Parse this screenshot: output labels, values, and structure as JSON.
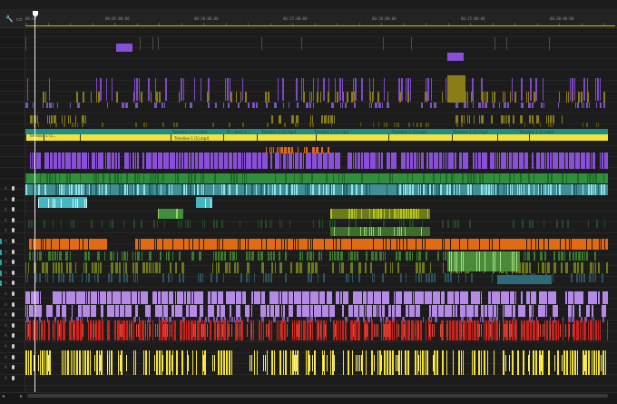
{
  "toolbar": {
    "wrench_icon": "wrench-icon",
    "wrench_glyph": "🔧",
    "markers_icon": "timeline-display-icon",
    "markers_glyph": "▭"
  },
  "ruler": {
    "start_label": "00:00",
    "timecodes": [
      "00:05:00:00",
      "00:10:00:00",
      "00:15:00:00",
      "00:20:00:00",
      "00:25:00:00",
      "00:30:00:00"
    ]
  },
  "clip_labels": {
    "v1": [
      "Timeline 1 (1...",
      "Timeline 1 (1).mp4",
      "Tr • Hme 1 (...",
      "Timeline 1 (1).mp4",
      "Timeline 1 (1).mp4",
      "Timeline 1 (1).mp4",
      "Timeline 1 (1).mp4",
      "Timeline 1 (1).mp4",
      "Timeline 1 (1).mp4"
    ]
  },
  "track_names": [
    "A",
    "A",
    "A",
    "A",
    "A",
    "A",
    "A",
    "A",
    "A",
    "A",
    "A",
    "A",
    "A",
    "A",
    "A",
    "A",
    "A",
    "A",
    "A"
  ],
  "colors": {
    "background": "#1c1c1c",
    "purple": "#8a4fd8",
    "lavender": "#b58ae6",
    "olive": "#8a7d18",
    "yellow": "#f2e23a",
    "teal": "#1f8f86",
    "green": "#2f8f3c",
    "cyan": "#45b7c2",
    "lime": "#b8c81e",
    "orange": "#e06b12",
    "red": "#c9231d",
    "ruler_accent": "#d2b800"
  },
  "scroll": {
    "left_glyph": "◂",
    "right_glyph": "▸"
  }
}
